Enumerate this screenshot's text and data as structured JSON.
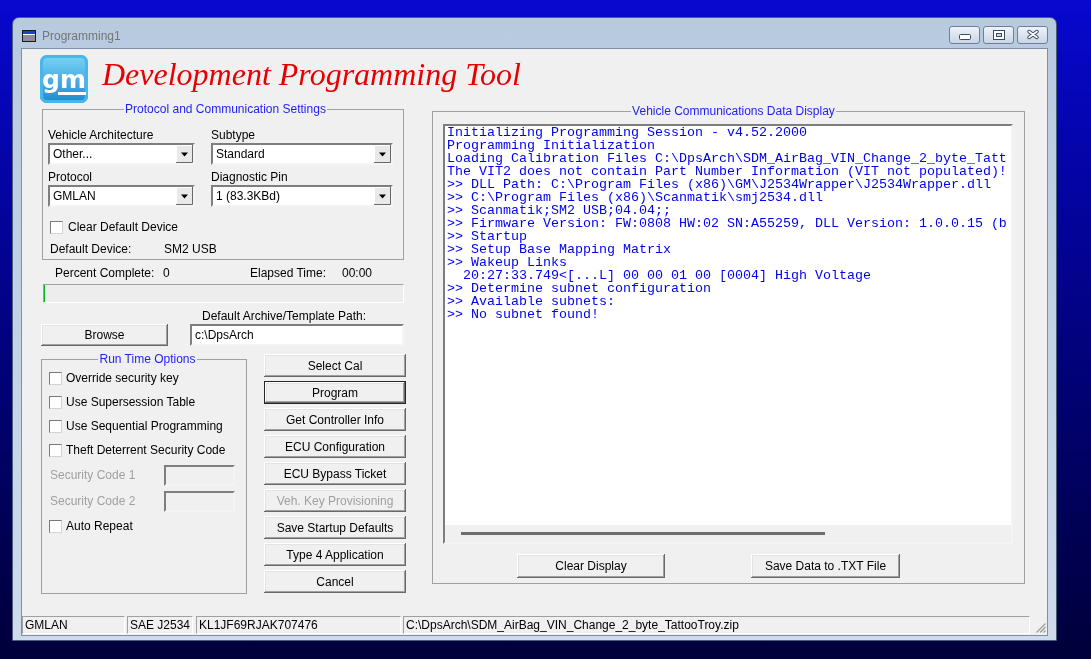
{
  "window": {
    "title": "Programming1"
  },
  "header": {
    "logo_text": "gm",
    "title": "Development Programming Tool"
  },
  "protocol_settings": {
    "title": "Protocol and Communication Settings",
    "fields": [
      {
        "label": "Vehicle Architecture",
        "value": "Other..."
      },
      {
        "label": "Subtype",
        "value": "Standard"
      },
      {
        "label": "Protocol",
        "value": "GMLAN"
      },
      {
        "label": "Diagnostic Pin",
        "value": "1 (83.3KBd)"
      }
    ],
    "clear_default_device": {
      "label": "Clear Default Device",
      "checked": false
    },
    "default_device": {
      "label": "Default Device:",
      "value": "SM2 USB"
    }
  },
  "progress": {
    "percent_label": "Percent Complete:",
    "percent_value": "0",
    "elapsed_label": "Elapsed Time:",
    "elapsed_value": "00:00",
    "level": 0
  },
  "archive": {
    "browse_button": "Browse",
    "path_label": "Default Archive/Template Path:",
    "path_value": "c:\\DpsArch"
  },
  "run_time_options": {
    "title": "Run Time Options",
    "items": [
      {
        "kind": "checkbox",
        "label": "Override security key",
        "checked": false,
        "disabled": false
      },
      {
        "kind": "checkbox",
        "label": "Use Supersession Table",
        "checked": false,
        "disabled": false
      },
      {
        "kind": "checkbox",
        "label": "Use Sequential Programming",
        "checked": false,
        "disabled": false
      },
      {
        "kind": "checkbox",
        "label": "Theft Deterrent Security Code",
        "checked": false,
        "disabled": false
      },
      {
        "kind": "code",
        "label": "Security Code 1",
        "disabled": true
      },
      {
        "kind": "code",
        "label": "Security Code 2",
        "disabled": true
      },
      {
        "kind": "checkbox",
        "label": "Auto Repeat",
        "checked": false,
        "disabled": false
      }
    ]
  },
  "action_buttons": [
    {
      "label": "Select Cal",
      "default": false,
      "disabled": false
    },
    {
      "label": "Program",
      "default": true,
      "disabled": false
    },
    {
      "label": "Get Controller Info",
      "default": false,
      "disabled": false
    },
    {
      "label": "ECU Configuration",
      "default": false,
      "disabled": false
    },
    {
      "label": "ECU Bypass Ticket",
      "default": false,
      "disabled": false
    },
    {
      "label": "Veh. Key Provisioning",
      "default": false,
      "disabled": true
    },
    {
      "label": "Save Startup Defaults",
      "default": false,
      "disabled": false
    },
    {
      "label": "Type 4 Application",
      "default": false,
      "disabled": false
    },
    {
      "label": "Cancel",
      "default": false,
      "disabled": false
    }
  ],
  "data_display": {
    "title": "Vehicle Communications Data Display",
    "lines": [
      "Initializing Programming Session - v4.52.2000",
      "Programming Initialization",
      "Loading Calibration Files C:\\DpsArch\\SDM_AirBag_VIN_Change_2_byte_Tatt",
      "The VIT2 does not contain Part Number Information (VIT not populated)!",
      ">> DLL Path: C:\\Program Files (x86)\\GM\\J2534Wrapper\\J2534Wrapper.dll",
      ">> C:\\Program Files (x86)\\Scanmatik\\smj2534.dll",
      ">> Scanmatik;SM2 USB;04.04;;",
      ">> Firmware Version: FW:0808 HW:02 SN:A55259, DLL Version: 1.0.0.15 (b",
      ">> Startup",
      ">> Setup Base Mapping Matrix",
      ">> Wakeup Links",
      "  20:27:33.749<[...L] 00 00 01 00 [0004] High Voltage",
      ">> Determine subnet configuration",
      ">> Available subnets:",
      ">> No subnet found!"
    ],
    "buttons": [
      "Clear Display",
      "Save Data to .TXT File"
    ]
  },
  "status_bar": {
    "panels": [
      "GMLAN",
      "SAE J2534",
      "KL1JF69RJAK707476",
      "C:\\DpsArch\\SDM_AirBag_VIN_Change_2_byte_TattooTroy.zip"
    ]
  }
}
